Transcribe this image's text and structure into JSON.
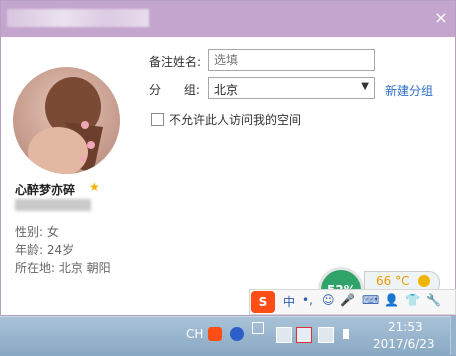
{
  "dialog": {
    "close_icon": "×",
    "nickname": "心醉梦亦碎",
    "star_icon": "★",
    "gender": "性别: 女",
    "age": "年龄: 24岁",
    "location": "所在地: 北京  朝阳"
  },
  "form": {
    "remark_label": "备注姓名:",
    "remark_placeholder": "选填",
    "group_label": "分      组:",
    "group_value": "北京",
    "new_group": "新建分组",
    "privacy_label": "不允许此人访问我的空间"
  },
  "widget": {
    "percent": "52%",
    "temperature": "66 °C"
  },
  "ime": {
    "logo": "S",
    "lang": "中",
    "punct": "•,",
    "emoji": "☺",
    "mic": "🎤",
    "keyboard": "⌨",
    "user": "👤",
    "shirt": "👕",
    "tools": "🔧"
  },
  "taskbar": {
    "lang_indicator": "CH",
    "time": "21:53",
    "date": "2017/6/23"
  },
  "colors": {
    "titlebar": "#c4a5cd",
    "accent_link": "#2b6fc7",
    "widget_green": "#2fa36a",
    "temp_orange": "#e99a00",
    "ime_red": "#ff4e15"
  }
}
